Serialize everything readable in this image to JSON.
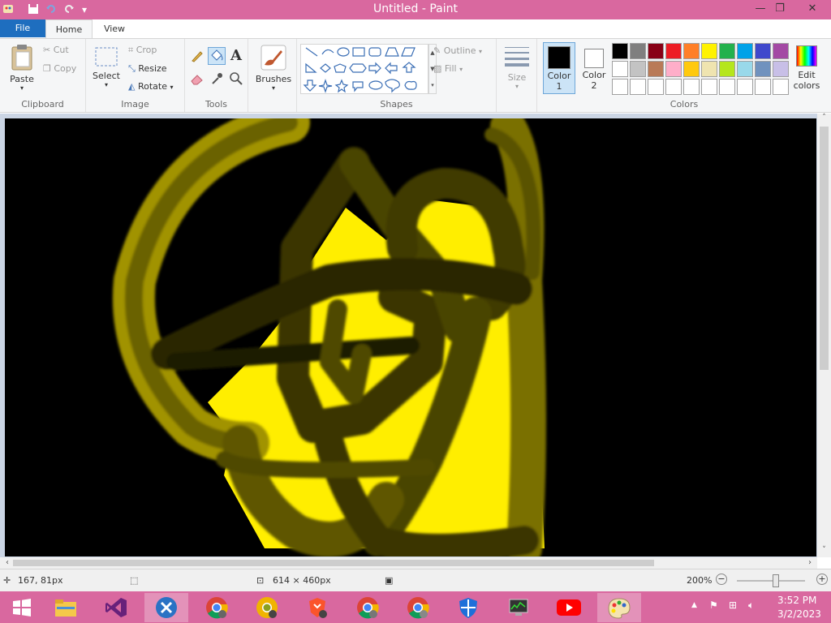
{
  "window": {
    "title": "Untitled - Paint"
  },
  "titlebar_controls": {
    "minimize": "—",
    "restore": "❐",
    "close": "✕"
  },
  "tabs": {
    "file": "File",
    "home": "Home",
    "view": "View"
  },
  "clipboard": {
    "paste": "Paste",
    "cut": "Cut",
    "copy": "Copy",
    "group": "Clipboard"
  },
  "image": {
    "select": "Select",
    "crop": "Crop",
    "resize": "Resize",
    "rotate": "Rotate",
    "group": "Image"
  },
  "tools": {
    "text_glyph": "A",
    "group": "Tools"
  },
  "brushes": {
    "label": "Brushes"
  },
  "shapes": {
    "outline": "Outline",
    "fill": "Fill",
    "group": "Shapes"
  },
  "size": {
    "label": "Size"
  },
  "colors": {
    "color1": "Color\n1",
    "color1_line1": "Color",
    "color1_line2": "1",
    "color2_line1": "Color",
    "color2_line2": "2",
    "edit_line1": "Edit",
    "edit_line2": "colors",
    "group": "Colors",
    "color1_value": "#000000",
    "color2_value": "#ffffff",
    "palette_row1": [
      "#000000",
      "#7f7f7f",
      "#880015",
      "#ed1c24",
      "#ff7f27",
      "#fff200",
      "#22b14c",
      "#00a2e8",
      "#3f48cc",
      "#a349a4"
    ],
    "palette_row2": [
      "#ffffff",
      "#c3c3c3",
      "#b97a57",
      "#ffaec9",
      "#ffc90e",
      "#efe4b0",
      "#b5e61d",
      "#99d9ea",
      "#7092be",
      "#c8bfe7"
    ],
    "palette_row3": [
      "#ffffff",
      "#ffffff",
      "#ffffff",
      "#ffffff",
      "#ffffff",
      "#ffffff",
      "#ffffff",
      "#ffffff",
      "#ffffff",
      "#ffffff"
    ]
  },
  "status": {
    "cursor": "167, 81px",
    "canvas_size": "614 × 460px",
    "zoom": "200%"
  },
  "tray": {
    "time": "3:52 PM",
    "date": "3/2/2023"
  }
}
